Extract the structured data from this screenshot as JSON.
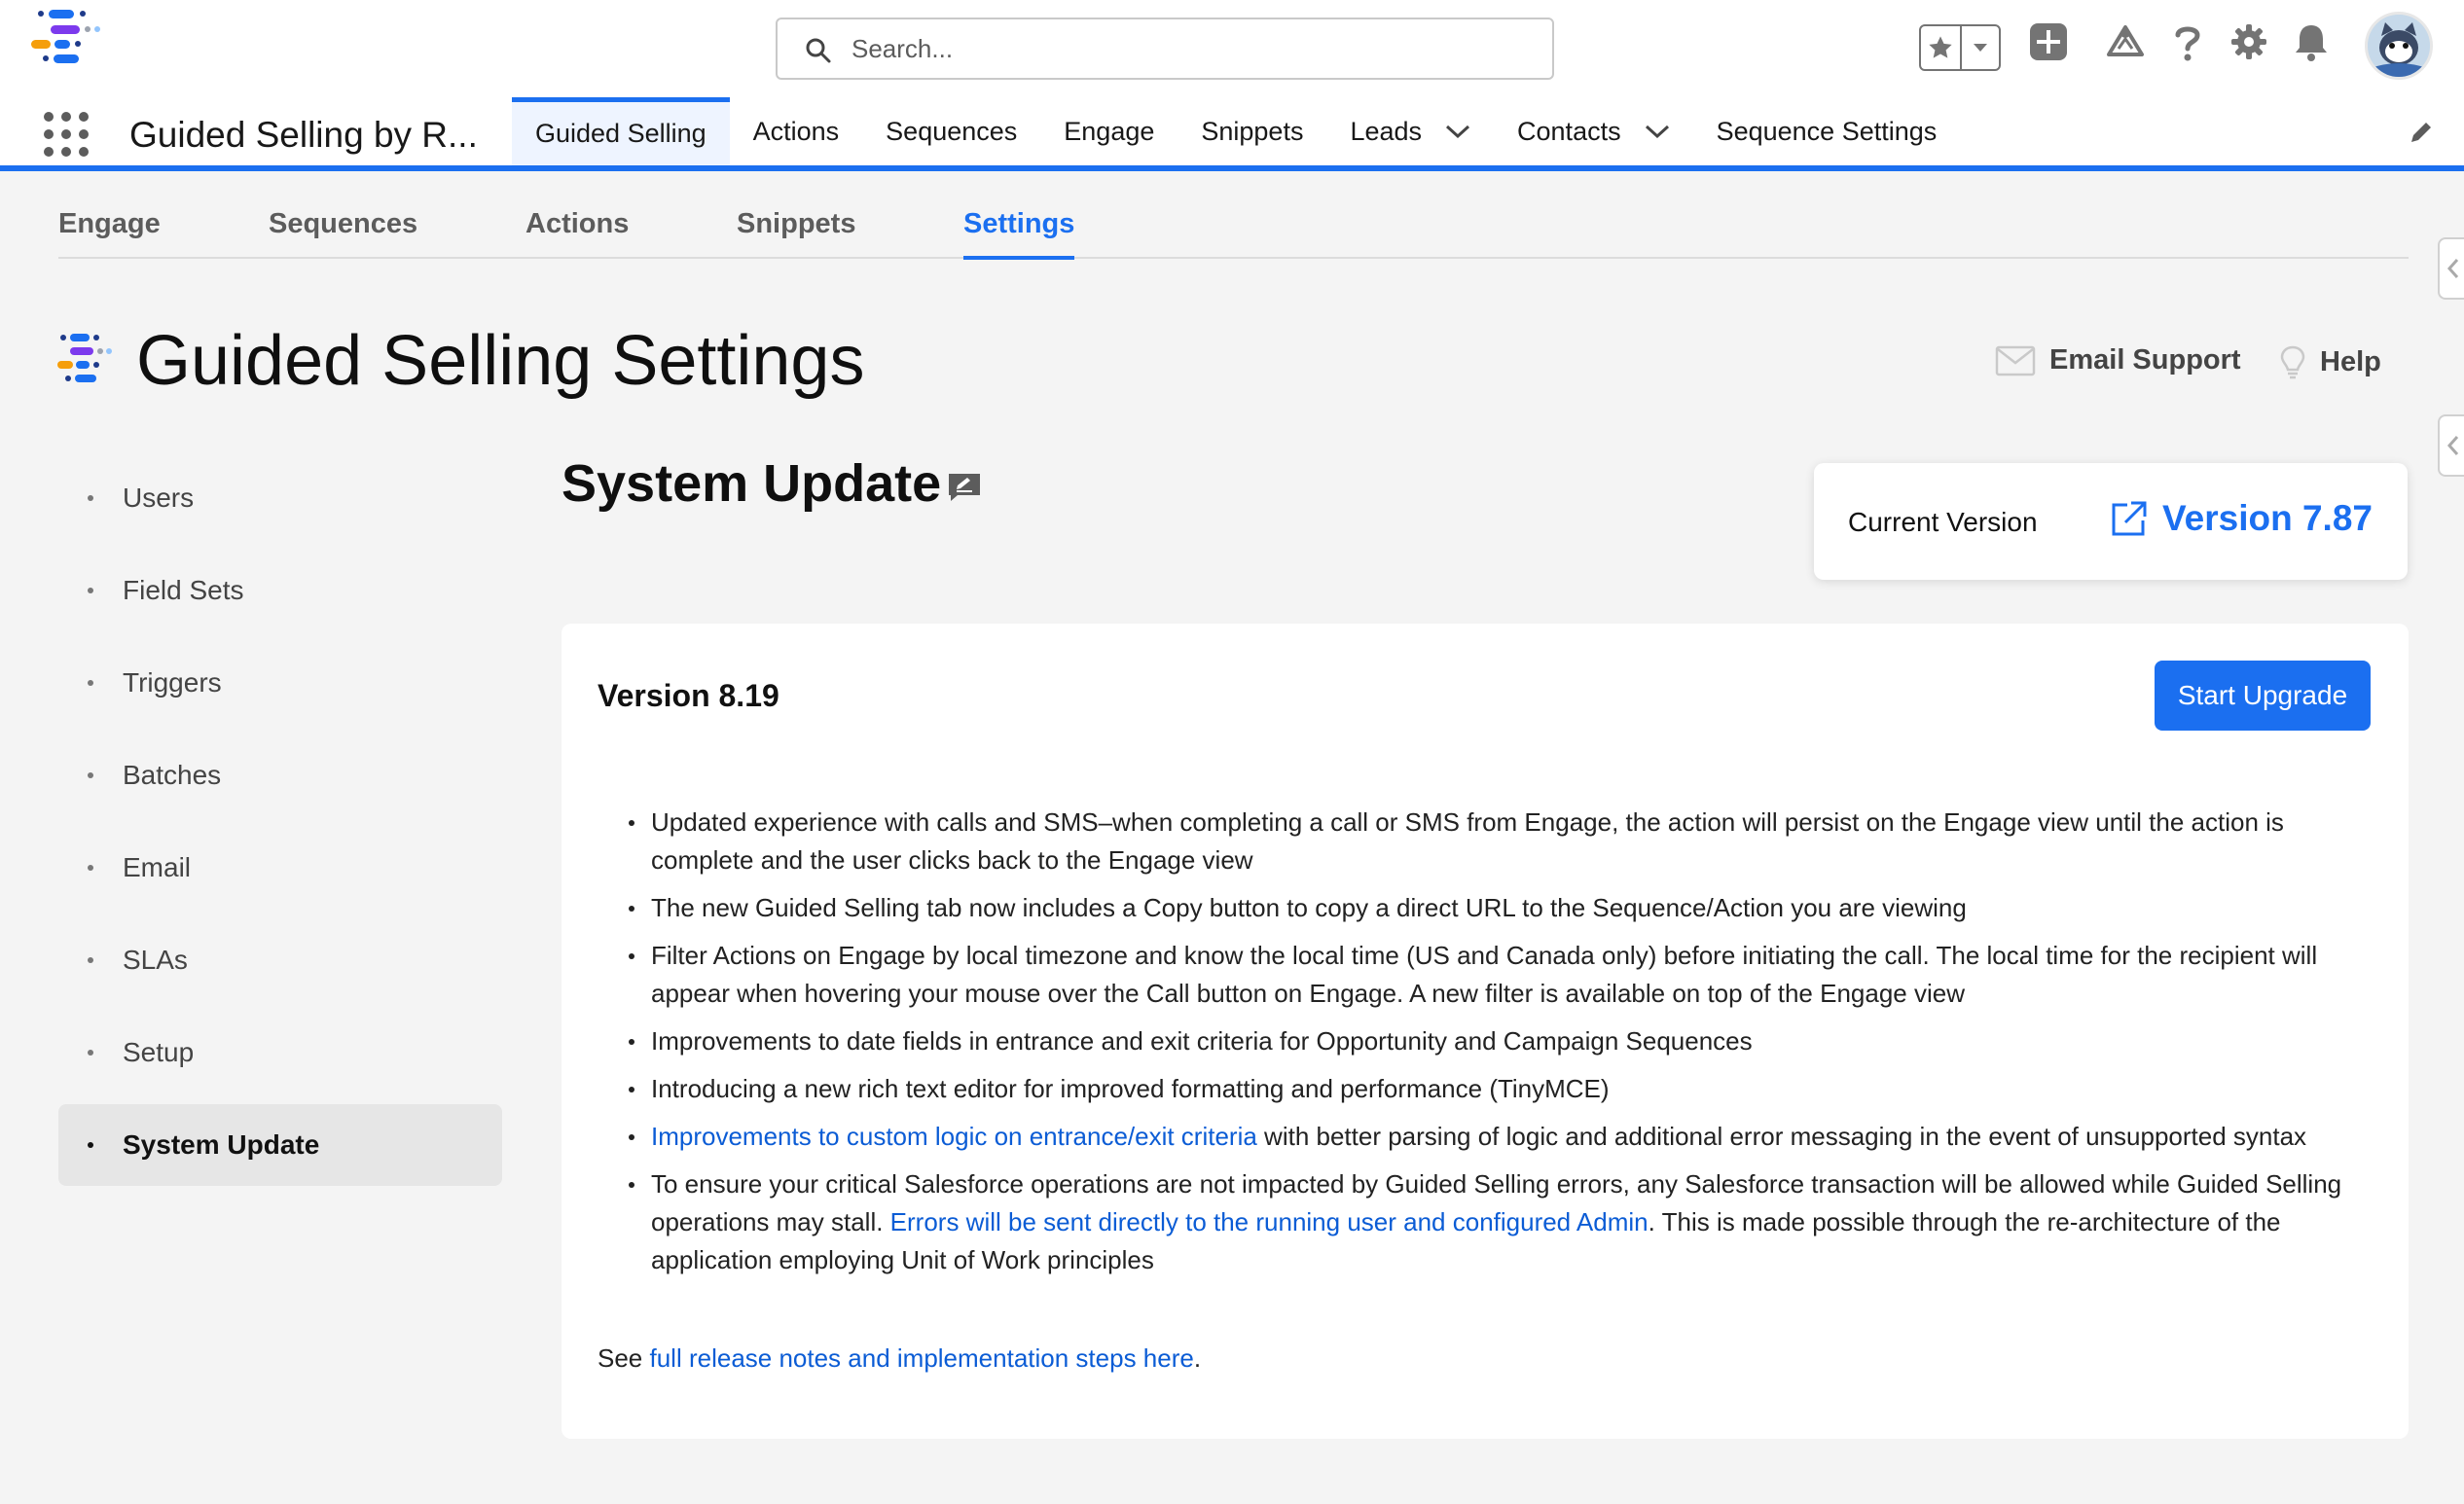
{
  "header": {
    "search_placeholder": "Search...",
    "icons": [
      "favorites-star-icon",
      "favorites-dropdown-icon",
      "global-add-icon",
      "trailhead-icon",
      "help-icon",
      "setup-gear-icon",
      "notifications-bell-icon",
      "user-avatar"
    ]
  },
  "context_bar": {
    "app_name": "Guided Selling by R...",
    "tabs": [
      {
        "label": "Guided Selling",
        "active": true,
        "dropdown": false
      },
      {
        "label": "Actions",
        "active": false,
        "dropdown": false
      },
      {
        "label": "Sequences",
        "active": false,
        "dropdown": false
      },
      {
        "label": "Engage",
        "active": false,
        "dropdown": false
      },
      {
        "label": "Snippets",
        "active": false,
        "dropdown": false
      },
      {
        "label": "Leads",
        "active": false,
        "dropdown": true
      },
      {
        "label": "Contacts",
        "active": false,
        "dropdown": true
      },
      {
        "label": "Sequence Settings",
        "active": false,
        "dropdown": false
      }
    ]
  },
  "subtabs": [
    {
      "label": "Engage",
      "active": false
    },
    {
      "label": "Sequences",
      "active": false
    },
    {
      "label": "Actions",
      "active": false
    },
    {
      "label": "Snippets",
      "active": false
    },
    {
      "label": "Settings",
      "active": true
    }
  ],
  "page": {
    "title": "Guided Selling Settings",
    "email_support": "Email Support",
    "help": "Help"
  },
  "left_nav": [
    {
      "label": "Users",
      "active": false
    },
    {
      "label": "Field Sets",
      "active": false
    },
    {
      "label": "Triggers",
      "active": false
    },
    {
      "label": "Batches",
      "active": false
    },
    {
      "label": "Email",
      "active": false
    },
    {
      "label": "SLAs",
      "active": false
    },
    {
      "label": "Setup",
      "active": false
    },
    {
      "label": "System Update",
      "active": true
    }
  ],
  "main": {
    "section_title": "System Update",
    "current_version_label": "Current Version",
    "current_version": "Version 7.87",
    "update": {
      "version": "Version 8.19",
      "button": "Start Upgrade",
      "notes": [
        {
          "parts": [
            {
              "text": "Updated experience with calls and SMS–when completing a call or SMS from Engage, the action will persist on the Engage view until the action is complete and the user clicks back to the Engage view",
              "link": false
            }
          ]
        },
        {
          "parts": [
            {
              "text": "The new Guided Selling tab now includes a Copy button to copy a direct URL to the Sequence/Action you are viewing",
              "link": false
            }
          ]
        },
        {
          "parts": [
            {
              "text": "Filter Actions on Engage by local timezone and know the local time (US and Canada only) before initiating the call. The local time for the recipient will appear when hovering your mouse over the Call button on Engage. A new filter is available on top of the Engage view",
              "link": false
            }
          ]
        },
        {
          "parts": [
            {
              "text": "Improvements to date fields in entrance and exit criteria for Opportunity and Campaign Sequences",
              "link": false
            }
          ]
        },
        {
          "parts": [
            {
              "text": "Introducing a new rich text editor for improved formatting and performance (TinyMCE)",
              "link": false
            }
          ]
        },
        {
          "parts": [
            {
              "text": "Improvements to custom logic on entrance/exit criteria",
              "link": true
            },
            {
              "text": " with better parsing of logic and additional error messaging in the event of unsupported syntax",
              "link": false
            }
          ]
        },
        {
          "parts": [
            {
              "text": "To ensure your critical Salesforce operations are not impacted by Guided Selling errors, any Salesforce transaction will be allowed while Guided Selling operations may stall. ",
              "link": false
            },
            {
              "text": "Errors will be sent directly to the running user and configured Admin",
              "link": true
            },
            {
              "text": ". This is made possible through the re-architecture of the application employing Unit of Work principles",
              "link": false
            }
          ]
        }
      ],
      "see_prefix": "See ",
      "see_link": "full release notes and implementation steps here",
      "see_suffix": "."
    }
  },
  "colors": {
    "brand_blue": "#1b6ff0",
    "link_blue": "#0b5cd5",
    "page_bg": "#f4f4f4"
  }
}
